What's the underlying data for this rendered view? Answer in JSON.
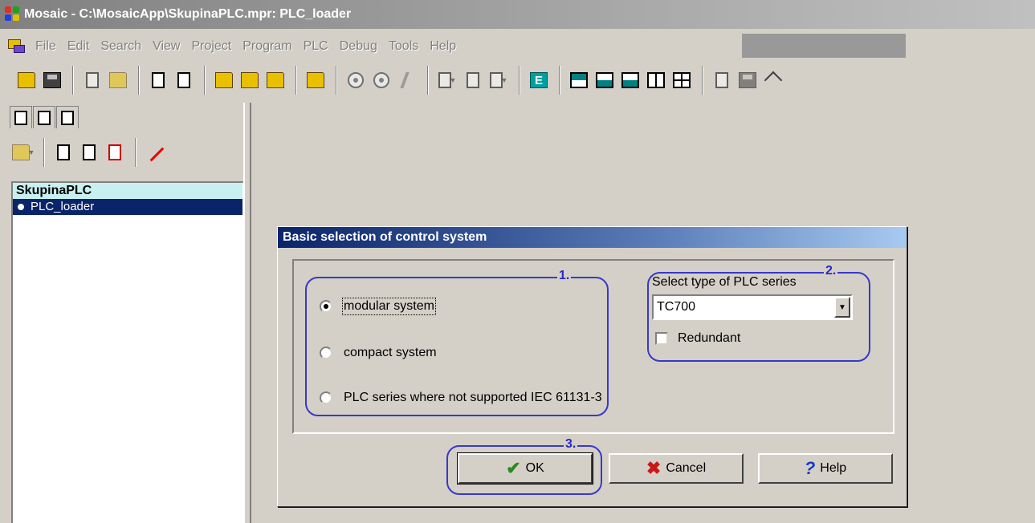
{
  "window": {
    "title": "Mosaic - C:\\MosaicApp\\SkupinaPLC.mpr: PLC_loader"
  },
  "menu": {
    "items": [
      "File",
      "Edit",
      "Search",
      "View",
      "Project",
      "Program",
      "PLC",
      "Debug",
      "Tools",
      "Help"
    ]
  },
  "tree": {
    "root": "SkupinaPLC",
    "item": "PLC_loader"
  },
  "dialog": {
    "title": "Basic selection of control system",
    "callouts": {
      "one": "1.",
      "two": "2.",
      "three": "3."
    },
    "radios": {
      "modular": "modular system",
      "compact": "compact system",
      "nonstandard": "PLC series where not supported IEC 61131-3",
      "selected": "modular system"
    },
    "series_label": "Select type of PLC series",
    "series_value": "TC700",
    "redundant_label": "Redundant",
    "redundant_checked": false,
    "buttons": {
      "ok": "OK",
      "cancel": "Cancel",
      "help": "Help"
    }
  },
  "colors": {
    "dialog_title_start": "#0a246a",
    "tree_selection": "#0a246a",
    "callout": "#3838c8",
    "ok_check": "#2a8a20",
    "cancel_x": "#c81818",
    "help_mark": "#1838c8"
  }
}
